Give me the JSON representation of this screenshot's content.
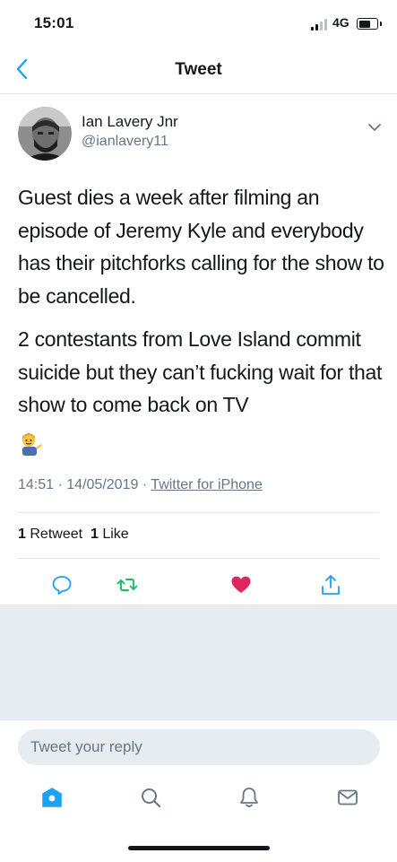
{
  "status_bar": {
    "time": "15:01",
    "network": "4G"
  },
  "nav": {
    "title": "Tweet",
    "back_icon": "chevron-left-icon"
  },
  "tweet": {
    "author": {
      "name": "Ian Lavery Jnr",
      "handle": "@ianlavery11"
    },
    "paragraphs": [
      "Guest dies a week after filming an episode of Jeremy Kyle and everybody has their pitchforks calling for the show to be cancelled.",
      "2 contestants from Love Island commit suicide but they can’t fucking wait for that show to come back on TV"
    ],
    "emoji": "man-tipping-hand-emoji",
    "time": "14:51",
    "date": "14/05/2019",
    "separator": "·",
    "source": "Twitter for iPhone",
    "retweets": {
      "count": "1",
      "label": "Retweet"
    },
    "likes": {
      "count": "1",
      "label": "Like"
    }
  },
  "actions": {
    "reply_icon": "reply-icon",
    "retweet_icon": "retweet-icon",
    "like_icon": "heart-icon",
    "share_icon": "share-icon",
    "retweet_color": "#17bf63",
    "like_color": "#e0245e",
    "accent_color": "#1da1f2"
  },
  "reply_box": {
    "placeholder": "Tweet your reply"
  },
  "tab_bar": {
    "items": [
      "home-icon",
      "search-icon",
      "notifications-icon",
      "messages-icon"
    ]
  }
}
